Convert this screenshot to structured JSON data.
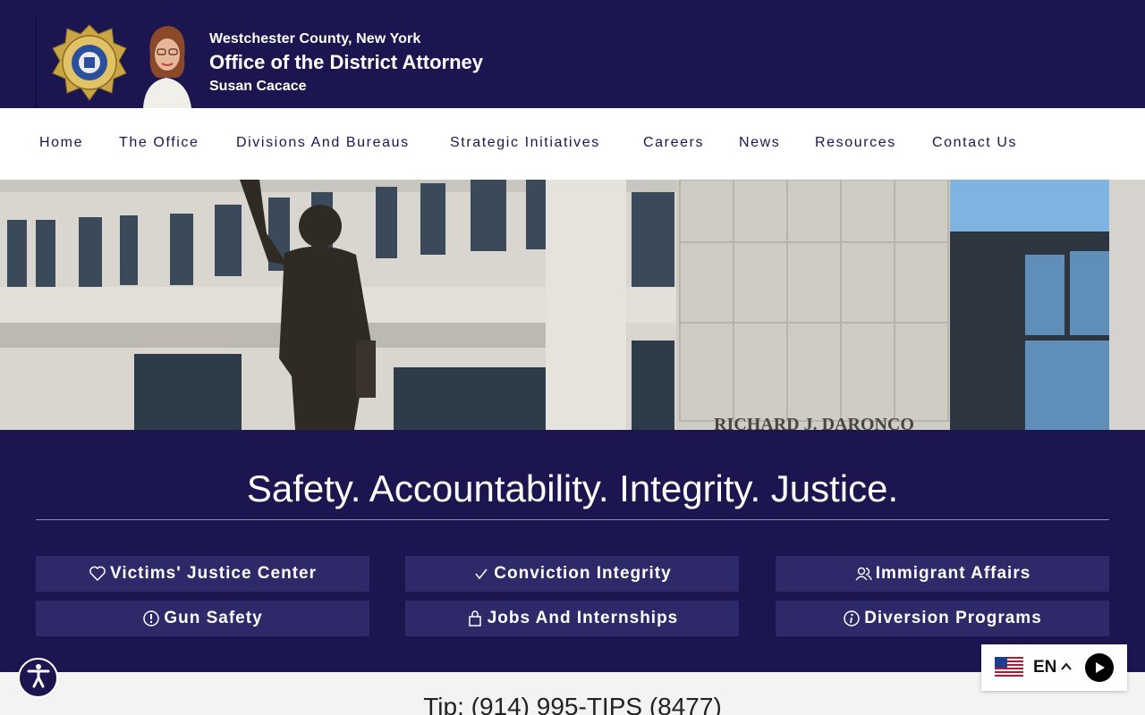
{
  "header": {
    "county": "Westchester County, New York",
    "office": "Office of the District Attorney",
    "name": "Susan Cacace"
  },
  "nav": {
    "items": [
      "Home",
      "The Office",
      "Divisions And Bureaus",
      "Strategic Initiatives",
      "Careers",
      "News",
      "Resources",
      "Contact Us"
    ]
  },
  "hero": {
    "building_inscription": "RICHARD J. DARONCO"
  },
  "band": {
    "tagline": "Safety. Accountability. Integrity. Justice.",
    "buttons": [
      {
        "label": "Victims' Justice Center",
        "icon": "heart-icon"
      },
      {
        "label": "Conviction Integrity",
        "icon": "check-icon"
      },
      {
        "label": "Immigrant Affairs",
        "icon": "users-icon"
      },
      {
        "label": "Gun Safety",
        "icon": "alert-circle-icon"
      },
      {
        "label": "Jobs And Internships",
        "icon": "bag-icon"
      },
      {
        "label": "Diversion Programs",
        "icon": "info-icon"
      }
    ]
  },
  "tip": "Tip: (914) 995-TIPS (8477)",
  "language": {
    "code": "EN"
  },
  "colors": {
    "navy": "#1b1650",
    "button": "#2e2a69",
    "nav_text": "#1b1650"
  }
}
